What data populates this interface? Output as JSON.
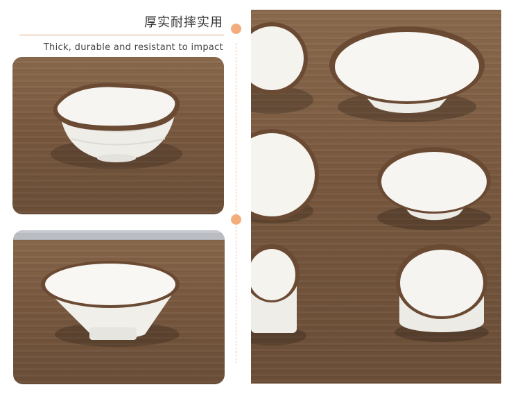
{
  "header": {
    "title_cn": "厚实耐摔实用",
    "subtitle_en": "Thick, durable and resistant to impact"
  },
  "colors": {
    "accent": "#f3ad7d",
    "rule": "#d9a77e",
    "wood": "#7a5a40",
    "rim": "#6b4a33",
    "bowl": "#f3f1ec"
  },
  "photos": {
    "photo1": "bowl on wood table",
    "photo2": "conical bowl on wood table",
    "photo3": "assorted bowls on wood table"
  }
}
